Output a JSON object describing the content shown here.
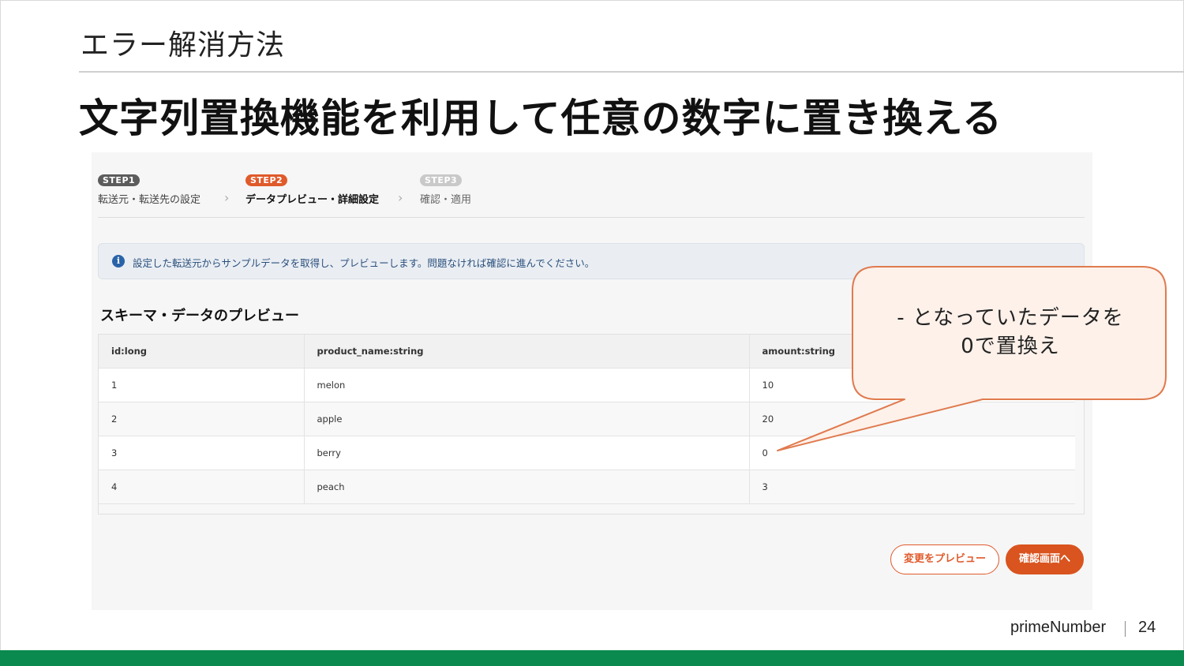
{
  "slide": {
    "section_title": "エラー解消方法",
    "headline": "文字列置換機能を利用して任意の数字に置き換える",
    "brand": "primeNumber",
    "page_number": "24",
    "accent_color": "#0a8a4e"
  },
  "steps": [
    {
      "badge": "STEP1",
      "label": "転送元・転送先の設定",
      "state": "done"
    },
    {
      "badge": "STEP2",
      "label": "データプレビュー・詳細設定",
      "state": "current"
    },
    {
      "badge": "STEP3",
      "label": "確認・適用",
      "state": "upcoming"
    }
  ],
  "info_message": "設定した転送元からサンプルデータを取得し、プレビューします。問題なければ確認に進んでください。",
  "schema_preview": {
    "title": "スキーマ・データのプレビュー",
    "columns": [
      "id:long",
      "product_name:string",
      "amount:string"
    ],
    "rows": [
      [
        "1",
        "melon",
        "10"
      ],
      [
        "2",
        "apple",
        "20"
      ],
      [
        "3",
        "berry",
        "0"
      ],
      [
        "4",
        "peach",
        "3"
      ]
    ]
  },
  "buttons": {
    "preview_changes": "変更をプレビュー",
    "to_confirm": "確認画面へ",
    "primary_color": "#d9541f"
  },
  "callout": {
    "line1": "- となっていたデータを",
    "line2": "0で置換え"
  }
}
